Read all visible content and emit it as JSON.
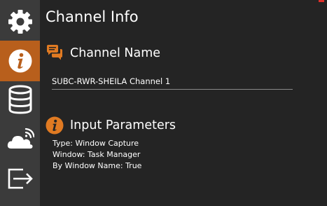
{
  "sidebar": {
    "items": [
      {
        "icon": "gear-icon",
        "active": false
      },
      {
        "icon": "info-icon",
        "active": true
      },
      {
        "icon": "database-icon",
        "active": false
      },
      {
        "icon": "cloud-broadcast-icon",
        "active": false
      },
      {
        "icon": "export-icon",
        "active": false
      }
    ]
  },
  "header": {
    "title": "Channel Info"
  },
  "channel_section": {
    "heading": "Channel Name",
    "icon": "chat-bubbles-icon",
    "value": "SUBC-RWR-SHEILA Channel 1"
  },
  "input_section": {
    "heading": "Input Parameters",
    "icon": "info-icon",
    "lines": [
      "Type: Window Capture",
      "Window: Task Manager",
      "By Window Name: True"
    ]
  },
  "colors": {
    "accent": "#b85f1c",
    "icon_orange": "#e07a22",
    "sidebar_bg": "#3b3b3b",
    "content_bg": "#242424",
    "close_red": "#e0302a"
  }
}
